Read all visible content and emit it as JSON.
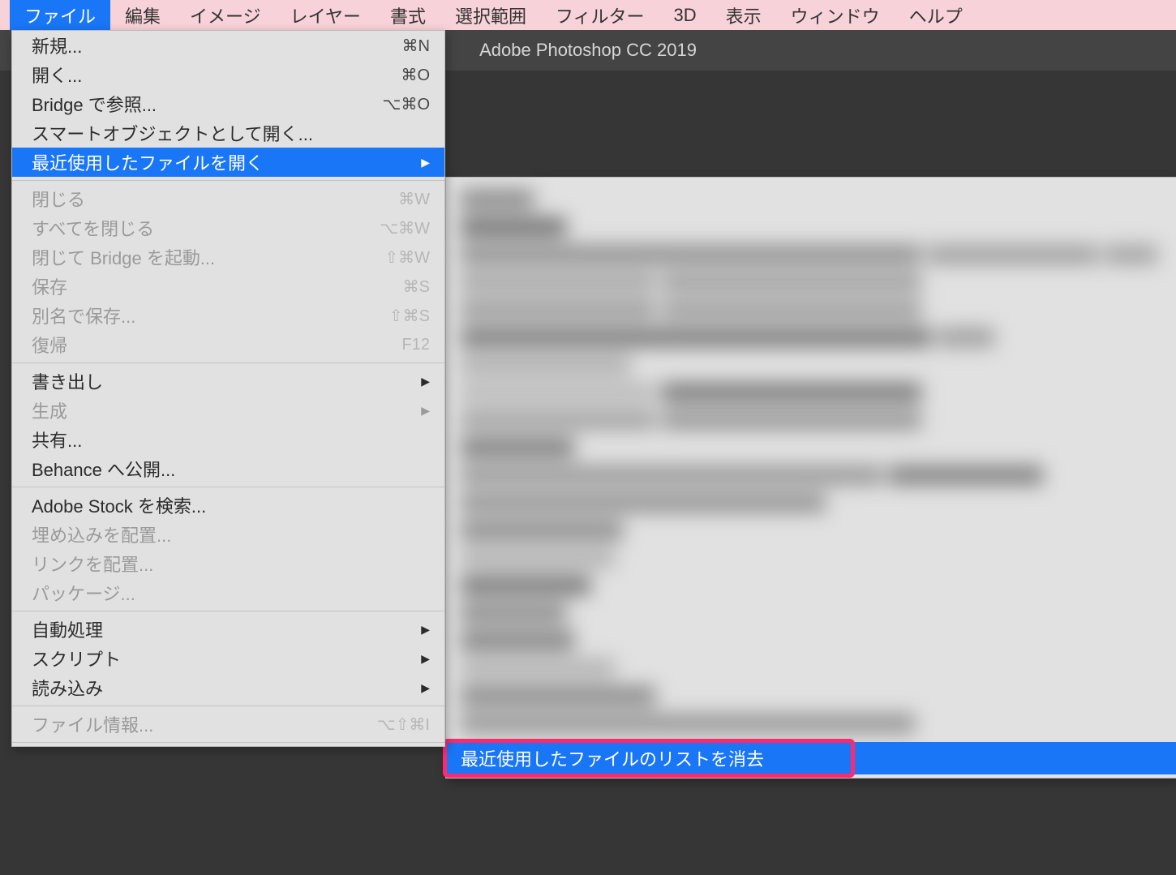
{
  "menubar": {
    "items": [
      {
        "label": "ファイル"
      },
      {
        "label": "編集"
      },
      {
        "label": "イメージ"
      },
      {
        "label": "レイヤー"
      },
      {
        "label": "書式"
      },
      {
        "label": "選択範囲"
      },
      {
        "label": "フィルター"
      },
      {
        "label": "3D"
      },
      {
        "label": "表示"
      },
      {
        "label": "ウィンドウ"
      },
      {
        "label": "ヘルプ"
      }
    ]
  },
  "titlebar": {
    "title": "Adobe Photoshop CC 2019"
  },
  "fileMenu": {
    "items": [
      {
        "label": "新規...",
        "shortcut": "⌘N",
        "disabled": false,
        "arrow": false
      },
      {
        "label": "開く...",
        "shortcut": "⌘O",
        "disabled": false,
        "arrow": false
      },
      {
        "label": "Bridge で参照...",
        "shortcut": "⌥⌘O",
        "disabled": false,
        "arrow": false
      },
      {
        "label": "スマートオブジェクトとして開く...",
        "shortcut": "",
        "disabled": false,
        "arrow": false
      },
      {
        "label": "最近使用したファイルを開く",
        "shortcut": "",
        "disabled": false,
        "arrow": true,
        "selected": true
      },
      {
        "sep": true
      },
      {
        "label": "閉じる",
        "shortcut": "⌘W",
        "disabled": true,
        "arrow": false
      },
      {
        "label": "すべてを閉じる",
        "shortcut": "⌥⌘W",
        "disabled": true,
        "arrow": false
      },
      {
        "label": "閉じて Bridge を起動...",
        "shortcut": "⇧⌘W",
        "disabled": true,
        "arrow": false
      },
      {
        "label": "保存",
        "shortcut": "⌘S",
        "disabled": true,
        "arrow": false
      },
      {
        "label": "別名で保存...",
        "shortcut": "⇧⌘S",
        "disabled": true,
        "arrow": false
      },
      {
        "label": "復帰",
        "shortcut": "F12",
        "disabled": true,
        "arrow": false
      },
      {
        "sep": true
      },
      {
        "label": "書き出し",
        "shortcut": "",
        "disabled": false,
        "arrow": true
      },
      {
        "label": "生成",
        "shortcut": "",
        "disabled": true,
        "arrow": true
      },
      {
        "label": "共有...",
        "shortcut": "",
        "disabled": false,
        "arrow": false
      },
      {
        "label": "Behance へ公開...",
        "shortcut": "",
        "disabled": false,
        "arrow": false
      },
      {
        "sep": true
      },
      {
        "label": "Adobe Stock を検索...",
        "shortcut": "",
        "disabled": false,
        "arrow": false
      },
      {
        "label": "埋め込みを配置...",
        "shortcut": "",
        "disabled": true,
        "arrow": false
      },
      {
        "label": "リンクを配置...",
        "shortcut": "",
        "disabled": true,
        "arrow": false
      },
      {
        "label": "パッケージ...",
        "shortcut": "",
        "disabled": true,
        "arrow": false
      },
      {
        "sep": true
      },
      {
        "label": "自動処理",
        "shortcut": "",
        "disabled": false,
        "arrow": true
      },
      {
        "label": "スクリプト",
        "shortcut": "",
        "disabled": false,
        "arrow": true
      },
      {
        "label": "読み込み",
        "shortcut": "",
        "disabled": false,
        "arrow": true
      },
      {
        "sep": true
      },
      {
        "label": "ファイル情報...",
        "shortcut": "⌥⇧⌘I",
        "disabled": true,
        "arrow": false
      },
      {
        "sep": true
      }
    ]
  },
  "submenu": {
    "clearLabel": "最近使用したファイルのリストを消去"
  }
}
